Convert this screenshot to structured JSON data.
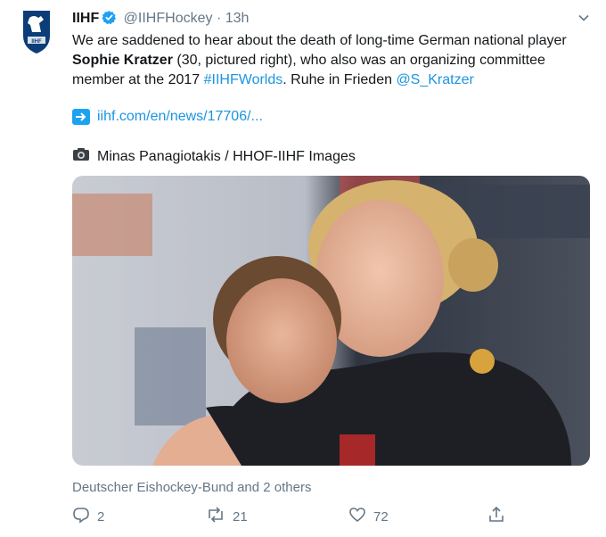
{
  "account": {
    "name": "IIHF",
    "handle": "@IIHFHockey",
    "separator": "·",
    "time": "13h",
    "avatar_label": "IIHF"
  },
  "tweet": {
    "text_1": "We are saddened to hear about the death of long-time German national player ",
    "text_bold": "Sophie Kratzer",
    "text_2": " (30, pictured right), who also was an organizing committee member at the 2017 ",
    "hashtag": "#IIHFWorlds",
    "text_3": ". Ruhe in Frieden ",
    "mention": "@S_Kratzer",
    "link": "iihf.com/en/news/17706/...",
    "photo_credit": "Minas Panagiotakis / HHOF-IIHF Images"
  },
  "social": {
    "liked_by": "Deutscher Eishockey-Bund and 2 others",
    "replies": "2",
    "retweets": "21",
    "likes": "72"
  },
  "colors": {
    "link": "#1b95e0",
    "muted": "#657786",
    "verified": "#1da1f2"
  }
}
